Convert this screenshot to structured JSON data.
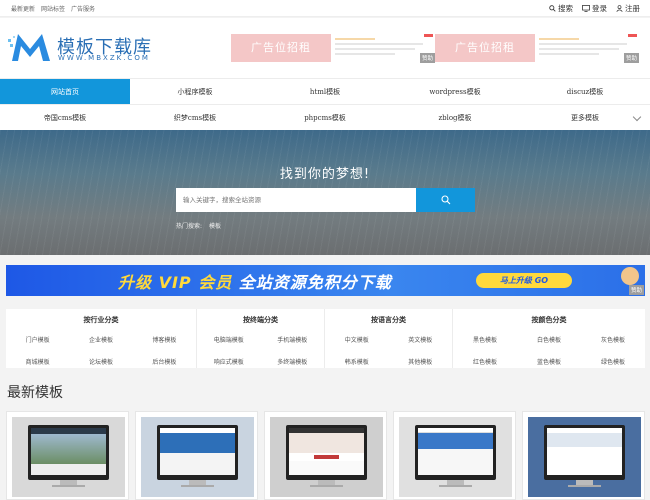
{
  "topbar": {
    "links": [
      "最新更新",
      "网站标签",
      "广告服务"
    ],
    "search": "搜索",
    "login": "登录",
    "register": "注册"
  },
  "logo": {
    "title": "模板下载库",
    "subtitle": "WWW.MBXZK.COM",
    "color": "#2a6fb5"
  },
  "ads": {
    "text": "广告位招租",
    "sponsor": "赞助"
  },
  "nav": {
    "row1": [
      "网站首页",
      "小程序模板",
      "html模板",
      "wordpress模板",
      "discuz模板"
    ],
    "row2": [
      "帝国cms模板",
      "织梦cms模板",
      "phpcms模板",
      "zblog模板",
      "更多模板"
    ],
    "active_color": "#1296db"
  },
  "hero": {
    "title": "找到你的梦想!",
    "placeholder": "输入关键字，搜索全站资源",
    "hot_label": "热门搜索:",
    "hot_items": [
      "模板"
    ]
  },
  "vip": {
    "text_a": "升级 VIP 会员",
    "text_b": "全站资源免积分下载",
    "button": "马上升级 GO",
    "sponsor": "赞助"
  },
  "categories": [
    {
      "title": "按行业分类",
      "items": [
        "门户模板",
        "企业模板",
        "博客模板",
        "商城模板",
        "论坛模板",
        "后台模板"
      ]
    },
    {
      "title": "按终端分类",
      "items": [
        "电脑端模板",
        "手机端模板",
        "响应式模板",
        "多终端模板"
      ]
    },
    {
      "title": "按语言分类",
      "items": [
        "中文模板",
        "英文模板",
        "韩系模板",
        "其他模板"
      ]
    },
    {
      "title": "按颜色分类",
      "items": [
        "黑色模板",
        "白色模板",
        "灰色模板",
        "红色模板",
        "蓝色模板",
        "绿色模板"
      ]
    }
  ],
  "newest": {
    "title": "最新模板",
    "cards": [
      {
        "name": "template-1",
        "accent": "#6b8fb3"
      },
      {
        "name": "template-2",
        "accent": "#2d6fb8"
      },
      {
        "name": "template-3",
        "accent": "#c23a3a"
      },
      {
        "name": "template-4",
        "accent": "#3a78c8"
      },
      {
        "name": "template-5",
        "accent": "#4a6ea0"
      }
    ]
  }
}
